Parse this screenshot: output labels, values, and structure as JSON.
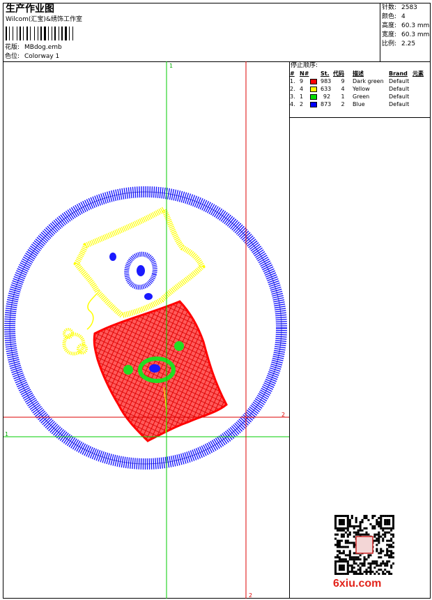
{
  "header": {
    "title": "生产作业图",
    "company": "Wilcom(汇宝)&绣饰工作室",
    "design_label": "花版:",
    "design_value": "MBdog.emb",
    "colorway_label": "色位:",
    "colorway_value": "Colorway 1"
  },
  "stats": [
    {
      "label": "针数:",
      "value": "2583"
    },
    {
      "label": "颜色:",
      "value": "4"
    },
    {
      "label": "高度:",
      "value": "60.3 mm"
    },
    {
      "label": "宽度:",
      "value": "60.3 mm"
    },
    {
      "label": "比例:",
      "value": "2.25"
    }
  ],
  "stop_sequence": {
    "heading": "停止顺序:",
    "columns": [
      "#",
      "N#",
      "St.",
      "代码",
      "描述",
      "Brand",
      "元素"
    ],
    "rows": [
      {
        "index": "1.",
        "n": "9",
        "color": "#ff0000",
        "stitches": "983",
        "code": "9",
        "desc": "Dark green",
        "brand": "Default"
      },
      {
        "index": "2.",
        "n": "4",
        "color": "#ffff00",
        "stitches": "633",
        "code": "4",
        "desc": "Yellow",
        "brand": "Default"
      },
      {
        "index": "3.",
        "n": "1",
        "color": "#00dd00",
        "stitches": "92",
        "code": "1",
        "desc": "Green",
        "brand": "Default"
      },
      {
        "index": "4.",
        "n": "2",
        "color": "#0000ff",
        "stitches": "873",
        "code": "2",
        "desc": "Blue",
        "brand": "Default"
      }
    ]
  },
  "guides": {
    "green_v": "1",
    "green_h": "1",
    "red_h": "2",
    "red_v": "2"
  },
  "footer": {
    "watermark": "6xiu.com"
  },
  "colors": {
    "guide_green": "#00cc00",
    "guide_red": "#dd0000",
    "ring_blue": "#1a1aff",
    "fill_red": "#ff0000",
    "outline_yellow": "#ffff00",
    "accent_green": "#22dd22"
  }
}
